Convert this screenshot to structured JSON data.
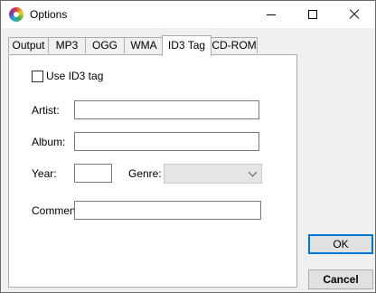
{
  "window": {
    "title": "Options"
  },
  "tabs": [
    {
      "label": "Output"
    },
    {
      "label": "MP3"
    },
    {
      "label": "OGG"
    },
    {
      "label": "WMA"
    },
    {
      "label": "ID3 Tag",
      "active": true
    },
    {
      "label": "CD-ROM"
    }
  ],
  "id3": {
    "use_label": "Use ID3 tag",
    "use_checked": false,
    "artist_label": "Artist:",
    "artist_value": "",
    "album_label": "Album:",
    "album_value": "",
    "year_label": "Year:",
    "year_value": "",
    "genre_label": "Genre:",
    "genre_value": "",
    "comment_label": "Comment:",
    "comment_value": ""
  },
  "buttons": {
    "ok": "OK",
    "cancel": "Cancel"
  },
  "colors": {
    "accent": "#0078d7",
    "window_bg": "#f0f0f0",
    "panel_bg": "#ffffff"
  }
}
